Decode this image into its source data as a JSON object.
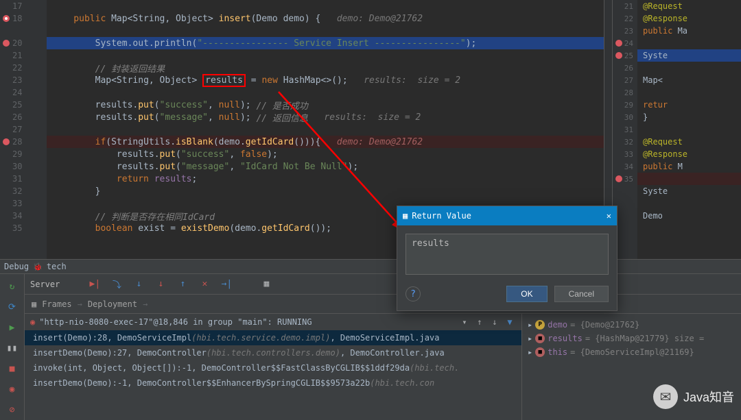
{
  "gutter_lines": [
    {
      "n": "17",
      "bp": false
    },
    {
      "n": "18",
      "bp": true,
      "active": true
    },
    {
      "n": "",
      "bp": false
    },
    {
      "n": "20",
      "bp": true
    },
    {
      "n": "21",
      "bp": false
    },
    {
      "n": "22",
      "bp": false
    },
    {
      "n": "23",
      "bp": false
    },
    {
      "n": "24",
      "bp": false
    },
    {
      "n": "25",
      "bp": false
    },
    {
      "n": "26",
      "bp": false
    },
    {
      "n": "27",
      "bp": false
    },
    {
      "n": "28",
      "bp": true
    },
    {
      "n": "29",
      "bp": false
    },
    {
      "n": "30",
      "bp": false
    },
    {
      "n": "31",
      "bp": false
    },
    {
      "n": "32",
      "bp": false
    },
    {
      "n": "33",
      "bp": false
    },
    {
      "n": "34",
      "bp": false
    },
    {
      "n": "35",
      "bp": false
    }
  ],
  "code": {
    "l18": {
      "pre": "    public ",
      "map": "Map",
      "g1": "<String, Object> ",
      "fn": "insert",
      "p": "(Demo demo) {   ",
      "anno": "demo: Demo@21762"
    },
    "l20": {
      "pre": "        ",
      "sys": "System.out.println",
      "p": "(",
      "s": "\"---------------- Service Insert ----------------\"",
      "e": ");"
    },
    "l22": {
      "pre": "        ",
      "c": "// 封装返回结果"
    },
    "l23": {
      "pre": "        ",
      "map": "Map",
      "g": "<String, Object> ",
      "id": "results",
      "eq": " = ",
      "kw": "new ",
      "t": "HashMap<>",
      "e": "();   ",
      "anno": "results:  size = 2"
    },
    "l25": {
      "pre": "        results.",
      "fn": "put",
      "p": "(",
      "s1": "\"success\"",
      "m": ", ",
      "kw": "null",
      "e": "); ",
      "c": "// 是否成功"
    },
    "l26": {
      "pre": "        results.",
      "fn": "put",
      "p": "(",
      "s1": "\"message\"",
      "m": ", ",
      "kw": "null",
      "e": "); ",
      "c": "// 返回信息",
      "anno": "   results:  size = 2"
    },
    "l28": {
      "pre": "        ",
      "kw": "if",
      "p": "(StringUtils.",
      "fn": "isBlank",
      "p2": "(demo.",
      "fn2": "getIdCard",
      "e": "())){   ",
      "anno": "demo: Demo@21762"
    },
    "l29": {
      "pre": "            results.",
      "fn": "put",
      "p": "(",
      "s1": "\"success\"",
      "m": ", ",
      "kw": "false",
      "e": ");"
    },
    "l30": {
      "pre": "            results.",
      "fn": "put",
      "p": "(",
      "s1": "\"message\"",
      "m": ", ",
      "s2": "\"IdCard Not Be Null\"",
      "e": ");"
    },
    "l31": {
      "pre": "            ",
      "kw": "return ",
      "id": "results",
      "e": ";"
    },
    "l32": {
      "pre": "        }"
    },
    "l34": {
      "pre": "        ",
      "c": "// 判断是否存在相同IdCard"
    },
    "l35": {
      "pre": "        ",
      "kw": "boolean ",
      "id": "exist",
      "eq": " = ",
      "fn": "existDemo",
      "p": "(demo.",
      "fn2": "getIdCard",
      "e": "());"
    }
  },
  "preview_gutter": [
    "21",
    "22",
    "23",
    "24",
    "25",
    "26",
    "27",
    "28",
    "29",
    "30",
    "31",
    "32",
    "33",
    "34",
    "35",
    "",
    "",
    "",
    ""
  ],
  "preview_bp": {
    "3": true,
    "4": true,
    "14": true
  },
  "preview": {
    "r0": {
      "a": "@Request"
    },
    "r1": {
      "a": "@Response"
    },
    "r2": {
      "kw": "public ",
      "t": "Ma"
    },
    "r4": {
      "t": "Syste"
    },
    "r6": {
      "t": "Map<"
    },
    "r8": {
      "kw": "retur"
    },
    "r9": {
      "t": "}"
    },
    "r11": {
      "a": "@Request"
    },
    "r12": {
      "a": "@Response"
    },
    "r13": {
      "kw": "public ",
      "t": "M"
    },
    "r15": {
      "t": "Syste"
    },
    "r17": {
      "t": "Demo"
    }
  },
  "debug_tab": {
    "label": "Debug",
    "icon": "🐞",
    "name": "tech"
  },
  "toolbar": {
    "server_label": "Server",
    "frames_label": "Frames",
    "deployment_label": "Deployment"
  },
  "thread": {
    "text": "\"http-nio-8080-exec-17\"@18,846 in group \"main\": RUNNING"
  },
  "frames": {
    "f0": {
      "m": "insert(Demo):28, DemoServiceImpl ",
      "i": "(hbi.tech.service.demo.impl)",
      "e": ", DemoServiceImpl.java"
    },
    "f1": {
      "m": "insertDemo(Demo):27, DemoController ",
      "i": "(hbi.tech.controllers.demo)",
      "e": ", DemoController.java"
    },
    "f2": {
      "m": "invoke(int, Object, Object[]):-1, DemoController$$FastClassByCGLIB$$1ddf29da ",
      "i": "(hbi.tech."
    },
    "f3": {
      "m": "insertDemo(Demo):-1, DemoController$$EnhancerBySpringCGLIB$$9573a22b ",
      "i": "(hbi.tech.con"
    }
  },
  "vars": {
    "v0": {
      "n": "demo",
      "v": " = {Demo@21762}"
    },
    "v1": {
      "n": "results",
      "v": " = {HashMap@21779} size ="
    },
    "v2": {
      "n": "this",
      "v": " = {DemoServiceImpl@21169}"
    }
  },
  "dialog": {
    "title": "Return Value",
    "value": "results",
    "ok": "OK",
    "cancel": "Cancel"
  },
  "watermark": "Java知音"
}
